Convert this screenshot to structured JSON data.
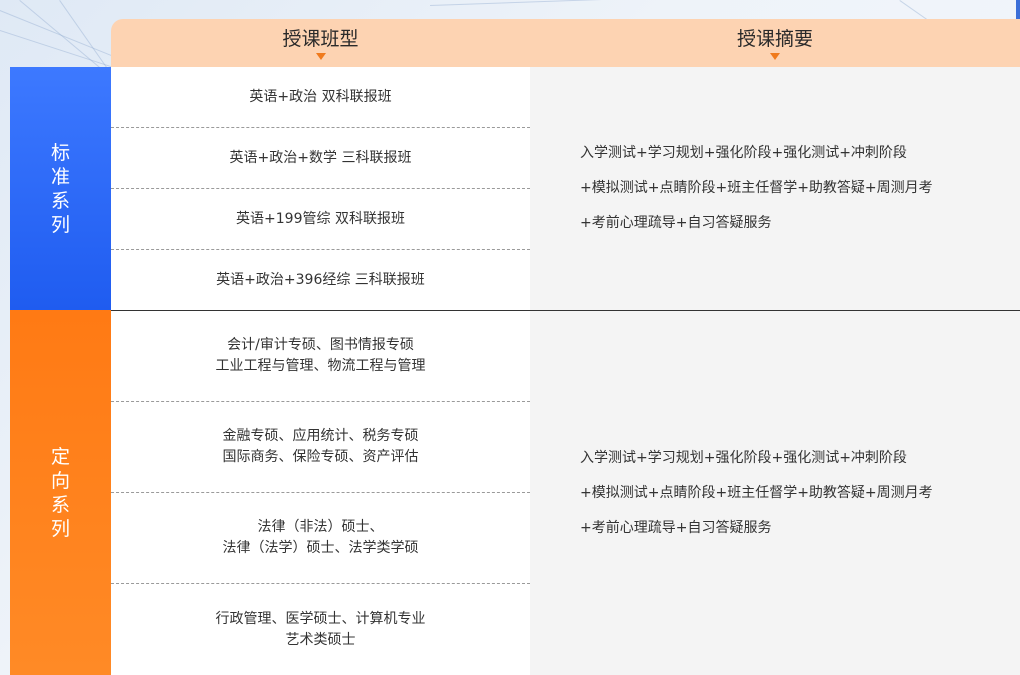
{
  "header": {
    "class_type_title": "授课班型",
    "summary_title": "授课摘要"
  },
  "colors": {
    "header_bg": "#fdd3b2",
    "header_arrow": "#f07a1c",
    "standard_series": "#2f6cff",
    "directed_series": "#ff7f1a",
    "summary_bg": "#f4f4f4"
  },
  "standard_series": {
    "label": "标准系列",
    "classes": [
      {
        "lines": [
          "英语+政治 双科联报班"
        ]
      },
      {
        "lines": [
          "英语+政治+数学 三科联报班"
        ]
      },
      {
        "lines": [
          "英语+199管综 双科联报班"
        ]
      },
      {
        "lines": [
          "英语+政治+396经综 三科联报班"
        ]
      }
    ],
    "summary": [
      "入学测试+学习规划+强化阶段+强化测试+冲刺阶段",
      "+模拟测试+点睛阶段+班主任督学+助教答疑+周测月考",
      "+考前心理疏导+自习答疑服务"
    ]
  },
  "directed_series": {
    "label": "定向系列",
    "classes": [
      {
        "lines": [
          "会计/审计专硕、图书情报专硕",
          "工业工程与管理、物流工程与管理"
        ]
      },
      {
        "lines": [
          "金融专硕、应用统计、税务专硕",
          "国际商务、保险专硕、资产评估"
        ]
      },
      {
        "lines": [
          "法律（非法）硕士、",
          "法律（法学）硕士、法学类学硕"
        ]
      },
      {
        "lines": [
          "行政管理、医学硕士、计算机专业",
          "艺术类硕士"
        ]
      }
    ],
    "summary": [
      "入学测试+学习规划+强化阶段+强化测试+冲刺阶段",
      "+模拟测试+点睛阶段+班主任督学+助教答疑+周测月考",
      "+考前心理疏导+自习答疑服务"
    ]
  }
}
